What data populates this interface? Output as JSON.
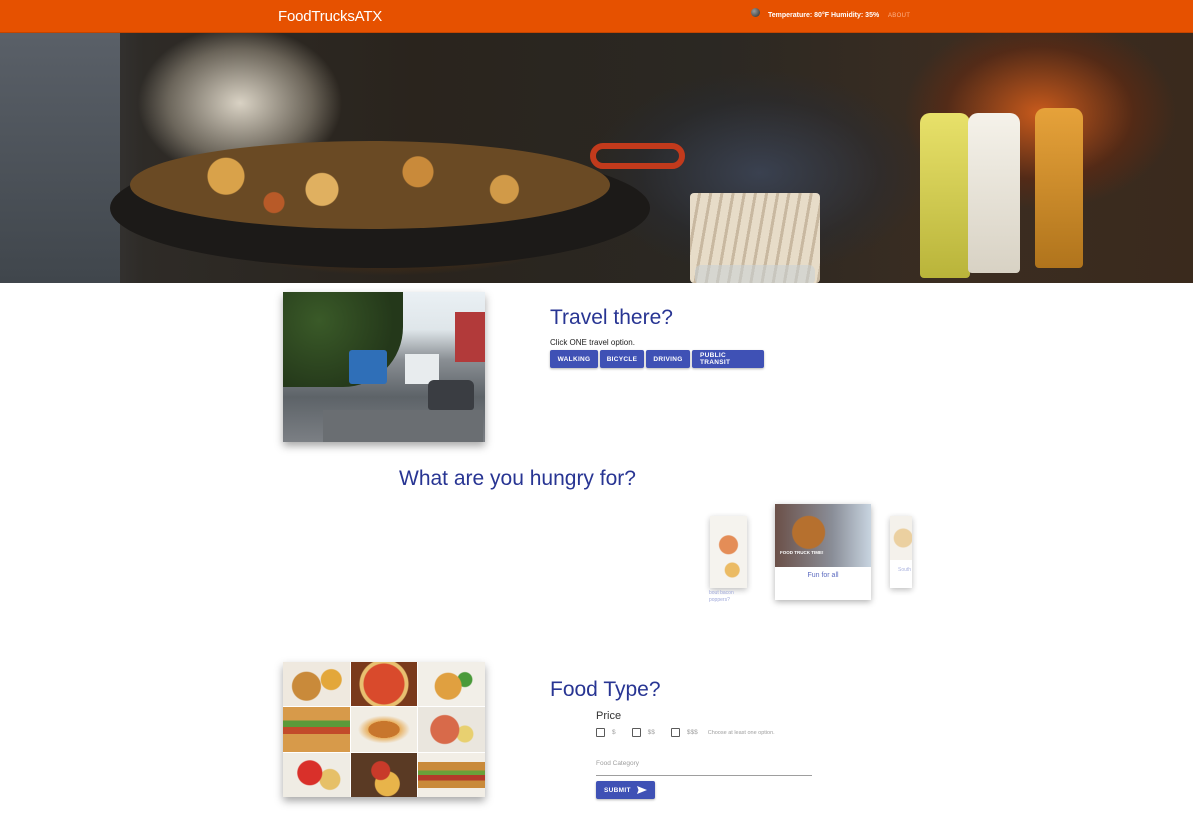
{
  "navbar": {
    "brand": "FoodTrucksATX",
    "weather": "Temperature: 80°F  Humidity: 35%",
    "about": "ABOUT",
    "icons": {
      "weather": "weather-icon"
    },
    "colors": {
      "background": "#e65100"
    }
  },
  "hero": {
    "image": "food-pan-photo"
  },
  "travel": {
    "title": "Travel there?",
    "hint": "Click ONE travel option.",
    "options": [
      "WALKING",
      "BICYCLE",
      "DRIVING",
      "PUBLIC TRANSIT"
    ],
    "image": "street-traffic-photo"
  },
  "hungry": {
    "title": "What are you hungry for?",
    "carousel": {
      "left_caption": "bout bacon poppers?",
      "center_overlay": "FOOD TRUCK TIME!",
      "center_caption": "Fun for all",
      "right_caption": "South"
    }
  },
  "foodtype": {
    "title": "Food Type?",
    "price_label": "Price",
    "price_options": [
      "$",
      "$$",
      "$$$"
    ],
    "price_note": "Choose at least one option.",
    "category_placeholder": "Food Category",
    "submit": "SUBMIT",
    "image": "food-collage-photo",
    "icons": {
      "submit": "send-icon"
    }
  },
  "colors": {
    "accent": "#3f51b5",
    "heading": "#283593",
    "brand": "#e65100"
  }
}
